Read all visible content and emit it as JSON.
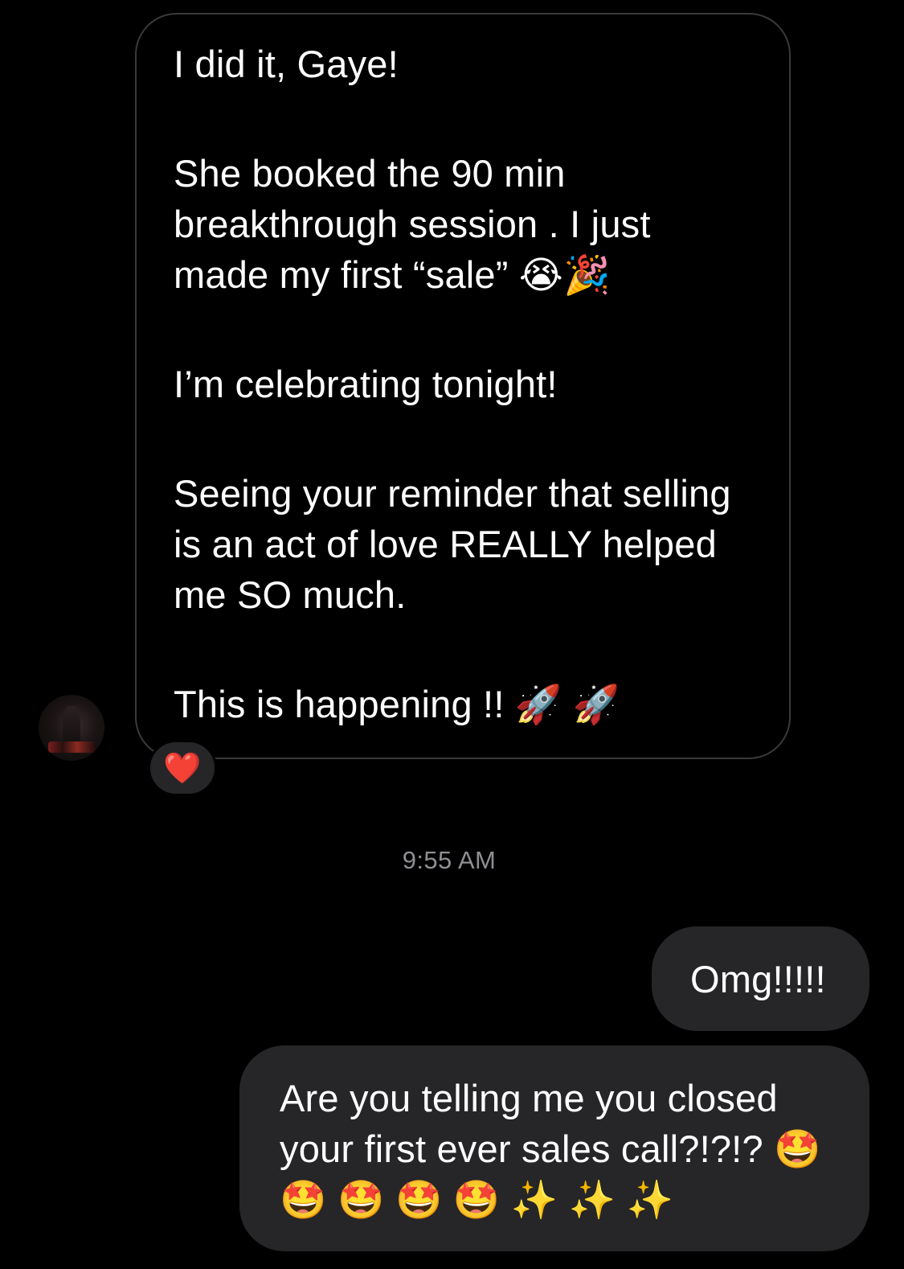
{
  "thread": {
    "incoming_message": {
      "lines": [
        "I did it, Gaye!",
        "",
        "She booked the 90 min",
        "breakthrough session . I just",
        "made my first “sale” 😭🎉",
        "",
        "I’m celebrating tonight!",
        "",
        "Seeing your reminder that selling",
        "is an act of love REALLY helped",
        "me SO much.",
        "",
        "This is happening !! 🚀  🚀"
      ],
      "reaction": "❤️"
    },
    "timestamp": "9:55 AM",
    "outgoing_messages": [
      {
        "lines": [
          "Omg!!!!!"
        ]
      },
      {
        "lines": [
          "Are you telling me you closed",
          "your first ever sales call?!?!? 🤩",
          "🤩 🤩 🤩 🤩 ✨ ✨ ✨"
        ]
      }
    ]
  },
  "colors": {
    "background": "#000000",
    "incoming_border": "#3a3a3c",
    "outgoing_bubble": "#262628",
    "timestamp_text": "#8e8e93",
    "text": "#ffffff"
  }
}
